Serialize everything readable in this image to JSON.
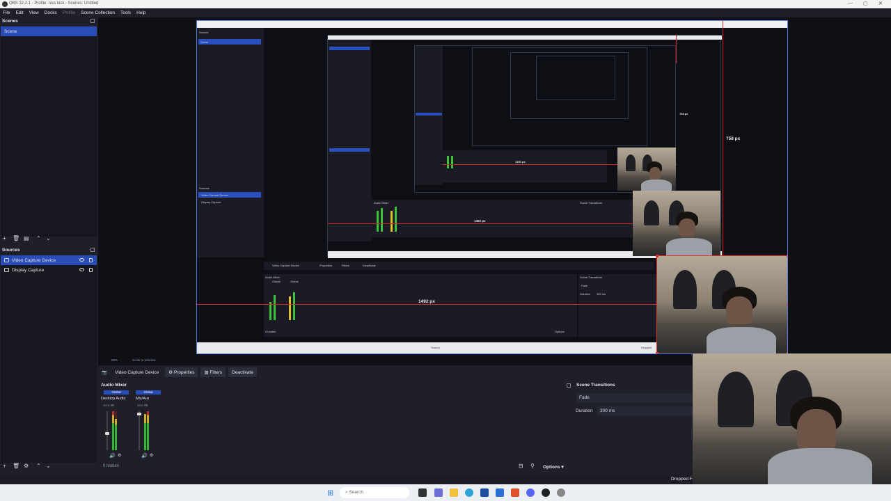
{
  "window": {
    "title": "OBS 32.2.1 - Profile: niss kick - Scenes: Untitled"
  },
  "menu": {
    "items": [
      "File",
      "Edit",
      "View",
      "Docks",
      "Profile",
      "Scene Collection",
      "Tools",
      "Help"
    ]
  },
  "scenes": {
    "title": "Scenes",
    "items": [
      {
        "label": "Scene",
        "selected": true
      }
    ]
  },
  "sources": {
    "title": "Sources",
    "items": [
      {
        "label": "Video Capture Device",
        "selected": true
      },
      {
        "label": "Display Capture",
        "selected": false
      }
    ]
  },
  "preview": {
    "width_label": "1492 px",
    "height_label": "758 px",
    "nested_width_label": "1492 px",
    "nested_height_label": "758 px",
    "nested_src_label": "Video Capture Device",
    "nested_properties": "Properties",
    "nested_filters": "Filters",
    "nested_deactivate": "Deactivate",
    "nested_audio_mixer": "Audio Mixer",
    "nested_scene_transitions": "Scene Transitions",
    "nested_fade": "Fade",
    "nested_duration": "Duration",
    "nested_duration_value": "300 ms",
    "nested_search": "Search",
    "nested_dropped": "Dropped",
    "nested_scene": "Scene",
    "nested_scenes": "Scenes",
    "nested_sources": "Sources",
    "nested_src1": "Video Capture Device",
    "nested_src2": "Display Capture",
    "nested_options": "Options",
    "nested_hidden": "0 hidden",
    "nested_global": "Global"
  },
  "controls": {
    "zoom_label": "88%",
    "scale_label": "Scale to Window",
    "source_name": "Video Capture Device",
    "properties": "Properties",
    "filters": "Filters",
    "deactivate": "Deactivate"
  },
  "mixer": {
    "title": "Audio Mixer",
    "channels": [
      {
        "name": "Desktop Audio",
        "level": "-24.5 dB",
        "tag": "Global"
      },
      {
        "name": "Mic/Aux",
        "level": "10.0 dB",
        "tag": "Global"
      }
    ],
    "scale": [
      "0",
      "-5",
      "-10",
      "-15",
      "-20",
      "-25",
      "-30",
      "-35",
      "-40",
      "-45",
      "-50",
      "-55",
      "-60"
    ],
    "hidden_label": "0 hidden",
    "options": "Options"
  },
  "transitions": {
    "title": "Scene Transitions",
    "type": "Fade",
    "duration_label": "Duration",
    "duration_value": "300 ms"
  },
  "status": {
    "dropped": "Dropped F"
  },
  "taskbar": {
    "search": "Search"
  }
}
